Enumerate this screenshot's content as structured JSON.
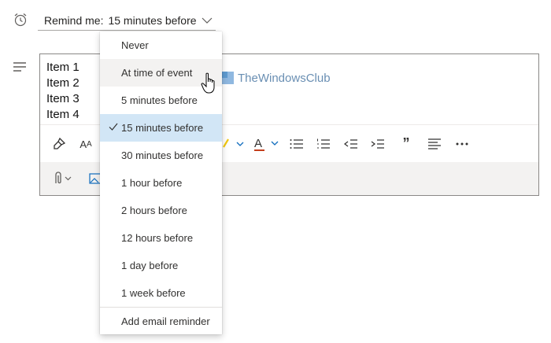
{
  "reminder": {
    "label": "Remind me:",
    "value": "15 minutes before"
  },
  "notes": {
    "items": [
      "Item 1",
      "Item 2",
      "Item 3",
      "Item 4"
    ]
  },
  "dropdown": {
    "options": [
      "Never",
      "At time of event",
      "5 minutes before",
      "15 minutes before",
      "30 minutes before",
      "1 hour before",
      "2 hours before",
      "12 hours before",
      "1 day before",
      "1 week before"
    ],
    "selected": "15 minutes before",
    "hovered": "At time of event",
    "footer": "Add email reminder"
  },
  "toolbar": {
    "row1_icons": [
      "format-painter-icon",
      "font-size-icon",
      "highlight-icon",
      "font-color-icon",
      "bullets-icon",
      "numbering-icon",
      "decrease-indent-icon",
      "increase-indent-icon",
      "quote-icon",
      "align-icon",
      "more-icon"
    ],
    "row2_icons": [
      "attach-icon",
      "image-icon"
    ]
  },
  "watermark": "TheWindowsClub",
  "colors": {
    "selected_bg": "#d2e6f6",
    "hover_bg": "#f3f2f1",
    "font_color_accent": "#c43e1c",
    "highlight_accent": "#f2c811",
    "chevron_blue": "#0f6cbd"
  }
}
